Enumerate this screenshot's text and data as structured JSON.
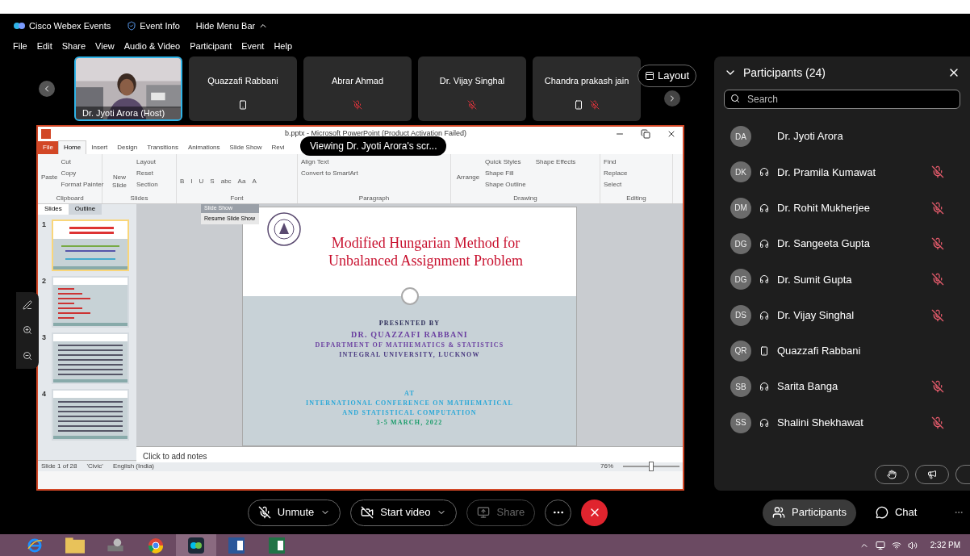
{
  "app_bar": {
    "app_name": "Cisco Webex Events",
    "event_info": "Event Info",
    "hide_menu": "Hide Menu Bar"
  },
  "menu": [
    "File",
    "Edit",
    "Share",
    "View",
    "Audio & Video",
    "Participant",
    "Event",
    "Help"
  ],
  "videos": [
    {
      "name": "Dr. Jyoti Arora  (Host)",
      "kind": "camera",
      "selected": true
    },
    {
      "name": "Quazzafi Rabbani",
      "kind": "tile",
      "selected": false,
      "phone": true,
      "muted": false
    },
    {
      "name": "Abrar Ahmad",
      "kind": "tile",
      "selected": false,
      "phone": false,
      "muted": true
    },
    {
      "name": "Dr. Vijay Singhal",
      "kind": "tile",
      "selected": false,
      "phone": false,
      "muted": true
    },
    {
      "name": "Chandra prakash jain",
      "kind": "tile",
      "selected": false,
      "phone": true,
      "muted": true
    }
  ],
  "layout_button": "Layout",
  "presentation": {
    "window_title": "b.pptx  -  Microsoft PowerPoint (Product Activation Failed)",
    "viewing_banner": "Viewing Dr. Jyoti Arora's scr...",
    "tabs": [
      {
        "label": "File",
        "kind": "file",
        "selected": false
      },
      {
        "label": "Home",
        "kind": "tab",
        "selected": true
      },
      {
        "label": "Insert",
        "kind": "tab",
        "selected": false
      },
      {
        "label": "Design",
        "kind": "tab",
        "selected": false
      },
      {
        "label": "Transitions",
        "kind": "tab",
        "selected": false
      },
      {
        "label": "Animations",
        "kind": "tab",
        "selected": false
      },
      {
        "label": "Slide Show",
        "kind": "tab",
        "selected": false
      },
      {
        "label": "Revi",
        "kind": "tab",
        "selected": false
      }
    ],
    "groups": [
      {
        "label": "Clipboard",
        "big": "Paste",
        "items": [
          "Cut",
          "Copy",
          "Format Painter"
        ]
      },
      {
        "label": "Slides",
        "big": "New Slide",
        "items": [
          "Layout",
          "Reset",
          "Section"
        ]
      },
      {
        "label": "Font",
        "items": [
          "B",
          "I",
          "U",
          "S",
          "abc",
          "Aa",
          "A"
        ]
      },
      {
        "label": "Paragraph",
        "items": [
          "Align Text",
          "Convert to SmartArt"
        ]
      },
      {
        "label": "Drawing",
        "big": "Arrange",
        "items": [
          "Quick Styles",
          "Shape Fill",
          "Shape Outline",
          "Shape Effects"
        ]
      },
      {
        "label": "Editing",
        "items": [
          "Find",
          "Replace",
          "Select"
        ]
      }
    ],
    "pane_tabs": [
      {
        "label": "Slides",
        "selected": true
      },
      {
        "label": "Outline",
        "selected": false
      }
    ],
    "thumbnails": [
      {
        "number": "1",
        "selected": true,
        "kind": "title"
      },
      {
        "number": "2",
        "selected": false,
        "kind": "list"
      },
      {
        "number": "3",
        "selected": false,
        "kind": "text"
      },
      {
        "number": "4",
        "selected": false,
        "kind": "text"
      }
    ],
    "slideshow_toolbar": {
      "title": "Slide Show",
      "action": "Resume Slide Show"
    },
    "slide": {
      "title": [
        "Modified Hungarian Method for",
        "Unbalanced Assignment Problem"
      ],
      "presented_by": "PRESENTED BY",
      "author": "DR. QUAZZAFI RABBANI",
      "department": "DEPARTMENT OF MATHEMATICS & STATISTICS",
      "university": "INTEGRAL UNIVERSITY, LUCKNOW",
      "at": "AT",
      "conference": [
        "INTERNATIONAL CONFERENCE ON MATHEMATICAL",
        "AND STATISTICAL COMPUTATION"
      ],
      "dates": "3-5 MARCH, 2022"
    },
    "notes": "Click to add notes",
    "status": [
      "Slide 1 of 28",
      "'Civic'",
      "English (India)"
    ],
    "zoom": {
      "reading": "76%",
      "level": 0.5
    }
  },
  "controls": [
    {
      "label": "Unmute",
      "kind": "mic",
      "disabled": false
    },
    {
      "label": "Start video",
      "kind": "video",
      "disabled": false
    },
    {
      "label": "Share",
      "kind": "share",
      "disabled": true
    }
  ],
  "participants": {
    "title": "Participants (24)",
    "search_placeholder": "Search",
    "people": [
      {
        "initials": "DA",
        "name": "Dr. Jyoti Arora",
        "kind": "none",
        "muted": false
      },
      {
        "initials": "DK",
        "name": "Dr. Pramila Kumawat",
        "kind": "headset",
        "muted": true
      },
      {
        "initials": "DM",
        "name": "Dr. Rohit Mukherjee",
        "kind": "headset",
        "muted": true
      },
      {
        "initials": "DG",
        "name": "Dr. Sangeeta Gupta",
        "kind": "headset",
        "muted": true
      },
      {
        "initials": "DG",
        "name": "Dr. Sumit Gupta",
        "kind": "headset",
        "muted": true
      },
      {
        "initials": "DS",
        "name": "Dr. Vijay Singhal",
        "kind": "headset",
        "muted": true
      },
      {
        "initials": "QR",
        "name": "Quazzafi Rabbani",
        "kind": "phone",
        "muted": false
      },
      {
        "initials": "SB",
        "name": "Sarita Banga",
        "kind": "headset",
        "muted": true
      },
      {
        "initials": "SS",
        "name": "Shalini Shekhawat",
        "kind": "headset",
        "muted": true
      }
    ]
  },
  "side_tabs": [
    {
      "label": "Participants",
      "kind": "participants",
      "selected": true
    },
    {
      "label": "Chat",
      "kind": "chat",
      "selected": false
    }
  ],
  "taskbar": {
    "apps": [
      {
        "kind": "ie",
        "selected": false
      },
      {
        "kind": "folder",
        "selected": false
      },
      {
        "kind": "tool",
        "selected": false
      },
      {
        "kind": "chrome",
        "selected": false
      },
      {
        "kind": "webex",
        "selected": true
      },
      {
        "kind": "word",
        "selected": false
      },
      {
        "kind": "excel",
        "selected": false
      }
    ],
    "time": "2:32 PM"
  }
}
